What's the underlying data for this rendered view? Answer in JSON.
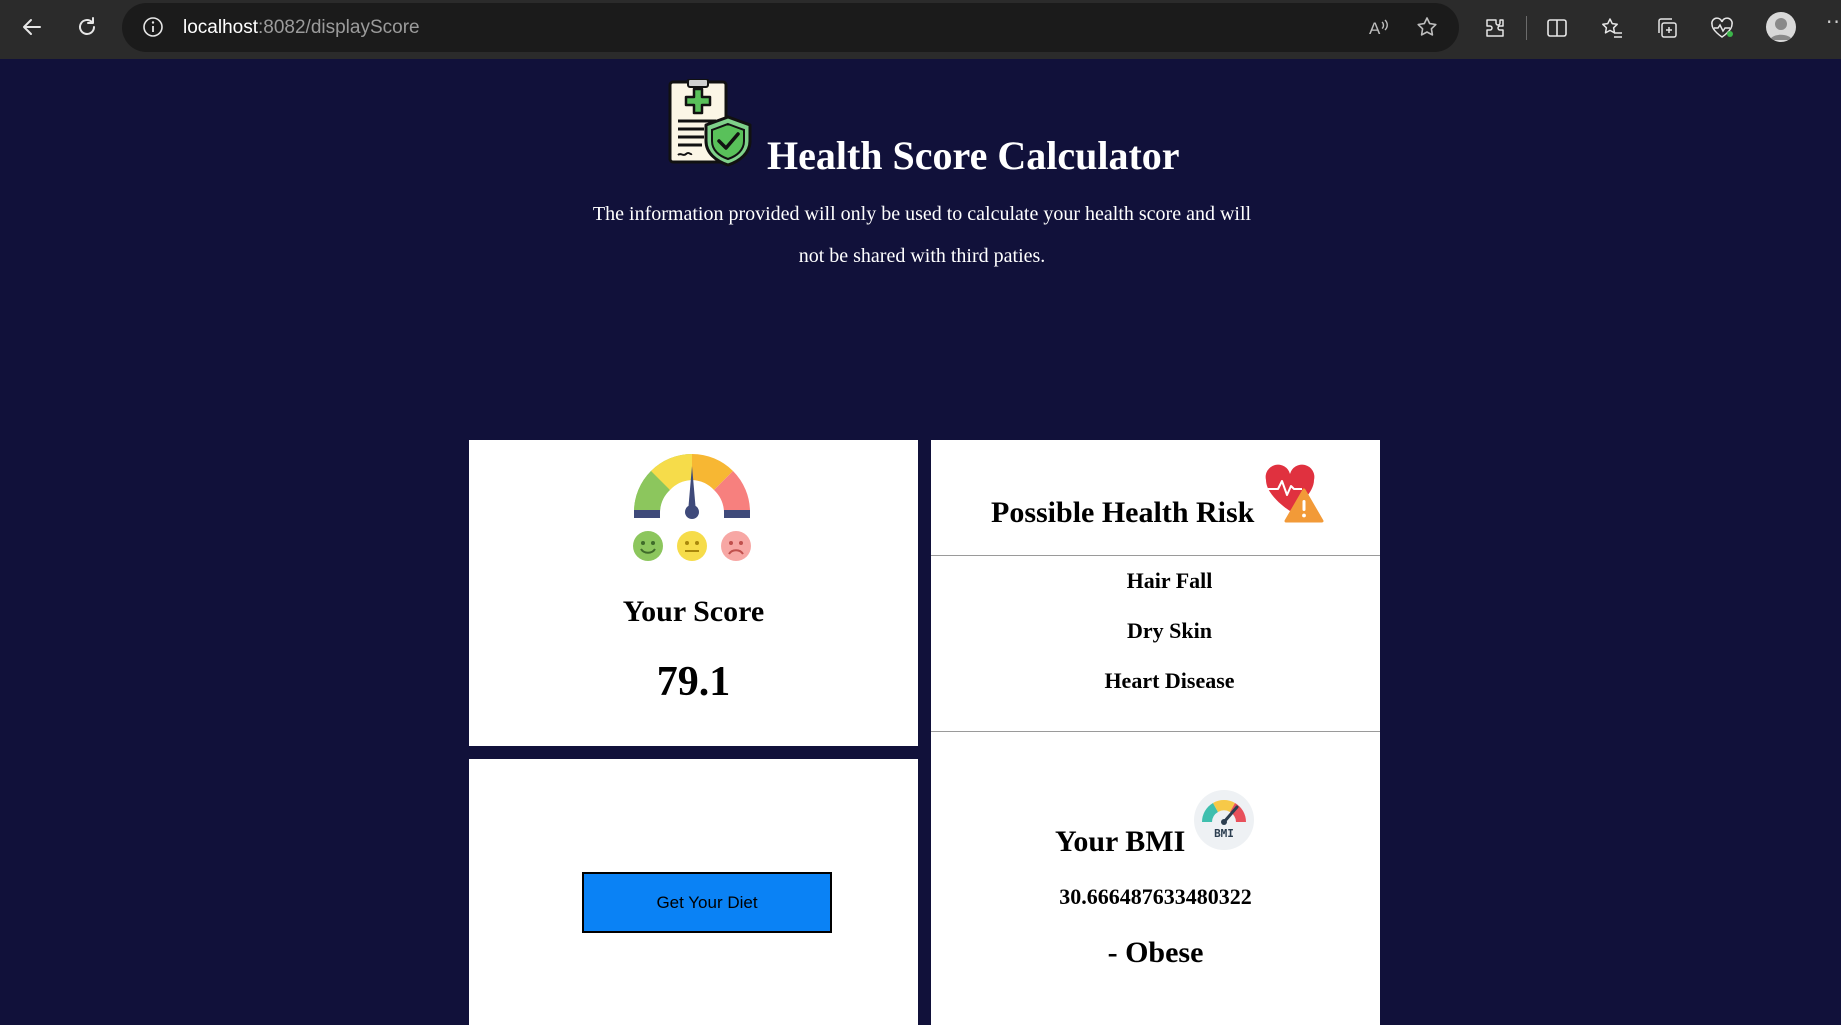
{
  "browser": {
    "url_host": "localhost",
    "url_rest": ":8082/displayScore",
    "icons": [
      "back-icon",
      "refresh-icon",
      "info-icon",
      "read-aloud-icon",
      "favorite-star-icon",
      "extensions-icon",
      "split-screen-icon",
      "favorites-icon",
      "collections-icon",
      "browser-essentials-icon",
      "profile-avatar-icon",
      "more-icon"
    ]
  },
  "header": {
    "title": "Health Score Calculator",
    "description_line1": "The information provided will only be used to calculate your health score and will",
    "description_line2": "not be shared with third paties."
  },
  "score": {
    "label": "Your Score",
    "value": "79.1"
  },
  "diet": {
    "button_label": "Get Your Diet"
  },
  "risk": {
    "title": "Possible Health Risk",
    "items": [
      "Hair Fall",
      "Dry Skin",
      "Heart Disease"
    ]
  },
  "bmi": {
    "title": "Your BMI",
    "icon_text": "BMI",
    "value": "30.666487633480322",
    "category": "- Obese"
  },
  "colors": {
    "page_bg": "#11113a",
    "button_bg": "#0a82f5",
    "card_bg": "#ffffff"
  }
}
